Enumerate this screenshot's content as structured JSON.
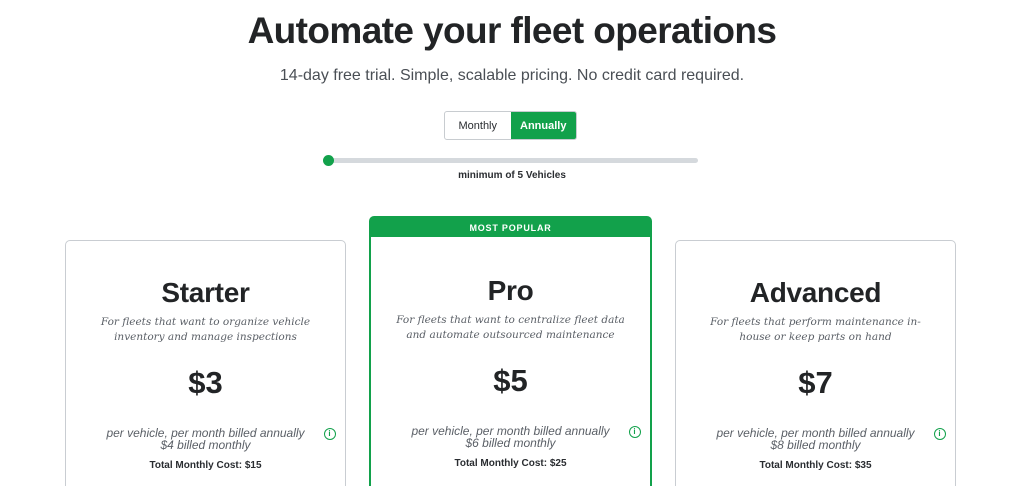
{
  "hero": {
    "title": "Automate your fleet operations",
    "subtitle": "14-day free trial. Simple, scalable pricing. No credit card required."
  },
  "billing_toggle": {
    "monthly": "Monthly",
    "annually": "Annually",
    "selected": "Annually"
  },
  "vehicle_slider": {
    "caption": "minimum of 5 Vehicles",
    "value_fraction": 0
  },
  "plans": [
    {
      "name": "Starter",
      "description": "For fleets that want to organize vehicle inventory and manage inspections",
      "price": "$3",
      "billing_line1": "per vehicle, per month billed annually",
      "billing_line2": "$4 billed monthly",
      "total": "Total Monthly Cost: $15"
    },
    {
      "badge": "MOST POPULAR",
      "name": "Pro",
      "description": "For fleets that want to centralize fleet data and automate outsourced maintenance",
      "price": "$5",
      "billing_line1": "per vehicle, per month billed annually",
      "billing_line2": "$6 billed monthly",
      "total": "Total Monthly Cost: $25"
    },
    {
      "name": "Advanced",
      "description": "For fleets that perform maintenance in-house or keep parts on hand",
      "price": "$7",
      "billing_line1": "per vehicle, per month billed annually",
      "billing_line2": "$8 billed monthly",
      "total": "Total Monthly Cost: $35"
    }
  ],
  "icons": {
    "info": "info-icon"
  },
  "colors": {
    "accent": "#12a14b",
    "text": "#222426",
    "muted": "#5a5f66"
  }
}
